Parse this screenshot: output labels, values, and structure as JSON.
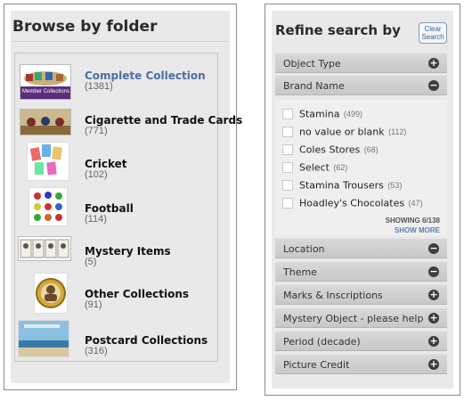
{
  "browse": {
    "title": "Browse by folder",
    "folders": [
      {
        "name": "Complete Collection",
        "count": "(1381)",
        "thumb_caption": "Member Collections"
      },
      {
        "name": "Cigarette and Trade Cards",
        "count": "(771)"
      },
      {
        "name": "Cricket",
        "count": "(102)"
      },
      {
        "name": "Football",
        "count": "(114)"
      },
      {
        "name": "Mystery Items",
        "count": "(5)"
      },
      {
        "name": "Other Collections",
        "count": "(91)"
      },
      {
        "name": "Postcard Collections",
        "count": "(316)"
      }
    ]
  },
  "refine": {
    "title": "Refine search by",
    "clear_label_line1": "Clear",
    "clear_label_line2": "Search",
    "facets_top": [
      {
        "label": "Object Type",
        "toggle": "+"
      },
      {
        "label": "Brand Name",
        "toggle": "−"
      }
    ],
    "brands": [
      {
        "name": "Stamina",
        "count": "(499)"
      },
      {
        "name": "no value or blank",
        "count": "(112)"
      },
      {
        "name": "Coles Stores",
        "count": "(68)"
      },
      {
        "name": "Select",
        "count": "(62)"
      },
      {
        "name": "Stamina Trousers",
        "count": "(53)"
      },
      {
        "name": "Hoadley's Chocolates",
        "count": "(47)"
      }
    ],
    "showing": "SHOWING 6/138",
    "show_more": "SHOW MORE",
    "facets_bottom": [
      {
        "label": "Location",
        "toggle": "−"
      },
      {
        "label": "Theme",
        "toggle": "−"
      },
      {
        "label": "Marks & Inscriptions",
        "toggle": "+"
      },
      {
        "label": "Mystery Object - please help",
        "toggle": "+"
      },
      {
        "label": "Period (decade)",
        "toggle": "+"
      },
      {
        "label": "Picture Credit",
        "toggle": "+"
      }
    ]
  }
}
